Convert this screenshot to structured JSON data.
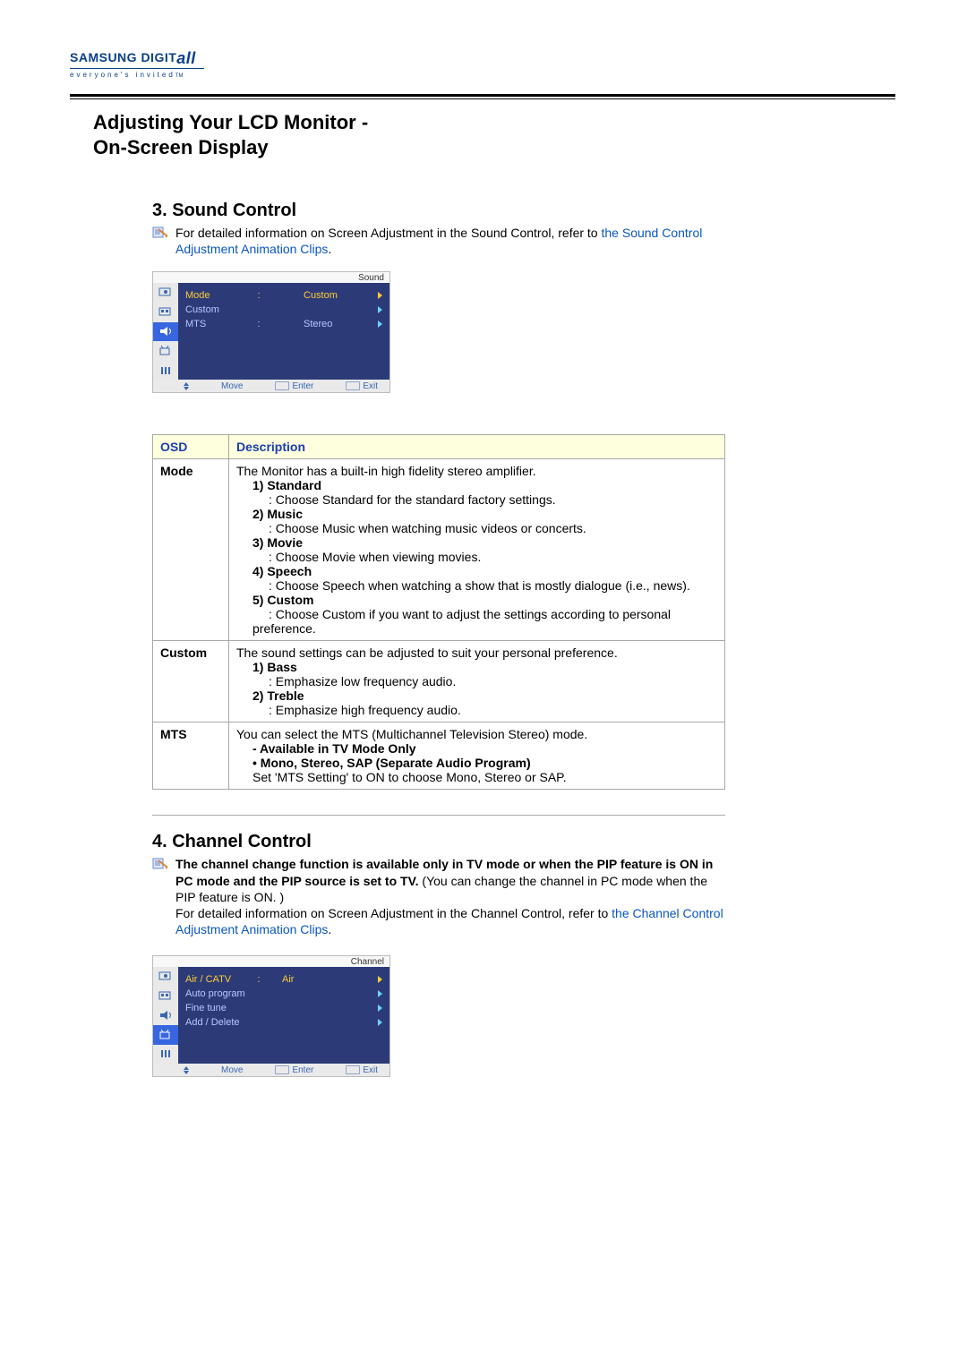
{
  "logo": {
    "brand": "SAMSUNG DIGIT",
    "brand_suffix": "all",
    "tagline": "everyone's invited",
    "tm": "TM"
  },
  "title": {
    "line1": "Adjusting Your LCD Monitor  -",
    "line2": "On-Screen Display"
  },
  "sound": {
    "heading": "3. Sound Control",
    "intro_pre": "For detailed information on Screen Adjustment in the Sound Control, refer to ",
    "intro_link": "the Sound Control Adjustment Animation Clips",
    "intro_post": "."
  },
  "osd_sound": {
    "label": "Sound",
    "rows": [
      {
        "label": "Mode",
        "value": "Custom",
        "sep": ":"
      },
      {
        "label": "Custom",
        "value": "",
        "sep": ""
      },
      {
        "label": "MTS",
        "value": "Stereo",
        "sep": ":"
      }
    ],
    "bottom": {
      "move": "Move",
      "enter": "Enter",
      "exit": "Exit"
    }
  },
  "table": {
    "h_osd": "OSD",
    "h_desc": "Description",
    "rows": [
      {
        "osd": "Mode",
        "lead": "The Monitor has a built-in high fidelity stereo amplifier.",
        "items": [
          {
            "label": "1) Standard",
            "desc": ": Choose Standard for the standard factory settings."
          },
          {
            "label": "2) Music",
            "desc": ": Choose Music when watching music videos or concerts."
          },
          {
            "label": "3) Movie",
            "desc": ": Choose Movie when viewing movies."
          },
          {
            "label": "4) Speech",
            "desc": ": Choose Speech when watching a show that is mostly dialogue (i.e., news)."
          },
          {
            "label": "5) Custom",
            "desc": ": Choose Custom if you want to adjust the settings according to personal preference."
          }
        ]
      },
      {
        "osd": "Custom",
        "lead": "The sound settings can be adjusted to suit your personal preference.",
        "items": [
          {
            "label": "1) Bass",
            "desc": ": Emphasize low frequency audio."
          },
          {
            "label": "2) Treble",
            "desc": ": Emphasize high frequency audio."
          }
        ]
      },
      {
        "osd": "MTS",
        "lead": "You can select the MTS (Multichannel Television Stereo) mode.",
        "bullets": [
          "- Available in TV Mode Only",
          "• Mono, Stereo, SAP (Separate Audio Program)"
        ],
        "tail": "Set 'MTS Setting' to ON to choose Mono, Stereo or SAP."
      }
    ]
  },
  "channel": {
    "heading": "4. Channel Control",
    "bold_part": "The channel change function is available only in TV mode or when the PIP feature is ON in PC mode and the PIP source is set to TV.",
    "after_bold": " (You can change the channel in PC mode when the PIP feature is ON. )",
    "intro2_pre": "For detailed information on Screen Adjustment in the Channel Control, refer to ",
    "intro2_link": "the Channel Control Adjustment Animation Clips",
    "intro2_post": "."
  },
  "osd_channel": {
    "label": "Channel",
    "rows": [
      {
        "label": "Air / CATV",
        "value": "Air",
        "sep": ":"
      },
      {
        "label": "Auto program",
        "value": "",
        "sep": ""
      },
      {
        "label": "Fine tune",
        "value": "",
        "sep": ""
      },
      {
        "label": "Add / Delete",
        "value": "",
        "sep": ""
      }
    ],
    "bottom": {
      "move": "Move",
      "enter": "Enter",
      "exit": "Exit"
    }
  }
}
